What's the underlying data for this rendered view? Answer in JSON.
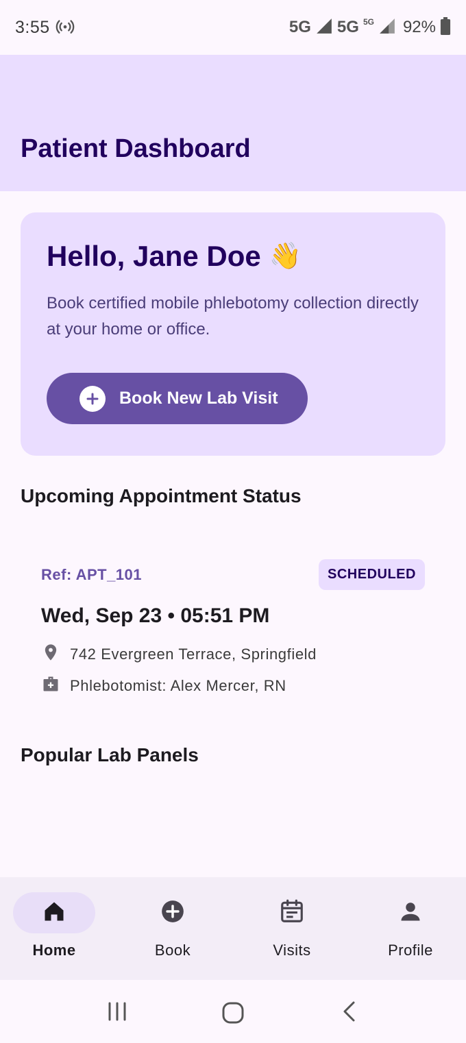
{
  "status_bar": {
    "time": "3:55",
    "network_1": "5G",
    "network_2": "5G",
    "network_3": "5G",
    "battery": "92%"
  },
  "app_bar": {
    "title": "Patient Dashboard"
  },
  "welcome": {
    "greeting": "Hello, Jane Doe",
    "emoji": "👋",
    "subtitle": "Book certified mobile phlebotomy collection directly at your home or office.",
    "book_button_label": "Book New Lab Visit"
  },
  "upcoming": {
    "section_title": "Upcoming Appointment Status",
    "ref": "Ref: APT_101",
    "status": "SCHEDULED",
    "datetime": "Wed, Sep 23 • 05:51 PM",
    "address": "742 Evergreen Terrace, Springfield",
    "phlebotomist": "Phlebotomist: Alex Mercer, RN"
  },
  "panels": {
    "section_title": "Popular Lab Panels"
  },
  "bottom_nav": {
    "items": [
      {
        "label": "Home",
        "icon": "home-icon",
        "active": true
      },
      {
        "label": "Book",
        "icon": "add-circle-icon",
        "active": false
      },
      {
        "label": "Visits",
        "icon": "calendar-icon",
        "active": false
      },
      {
        "label": "Profile",
        "icon": "person-icon",
        "active": false
      }
    ]
  },
  "colors": {
    "primary": "#6750a4",
    "primary_container": "#eaddff",
    "on_primary_container": "#21005d",
    "background": "#fdf7fe"
  }
}
